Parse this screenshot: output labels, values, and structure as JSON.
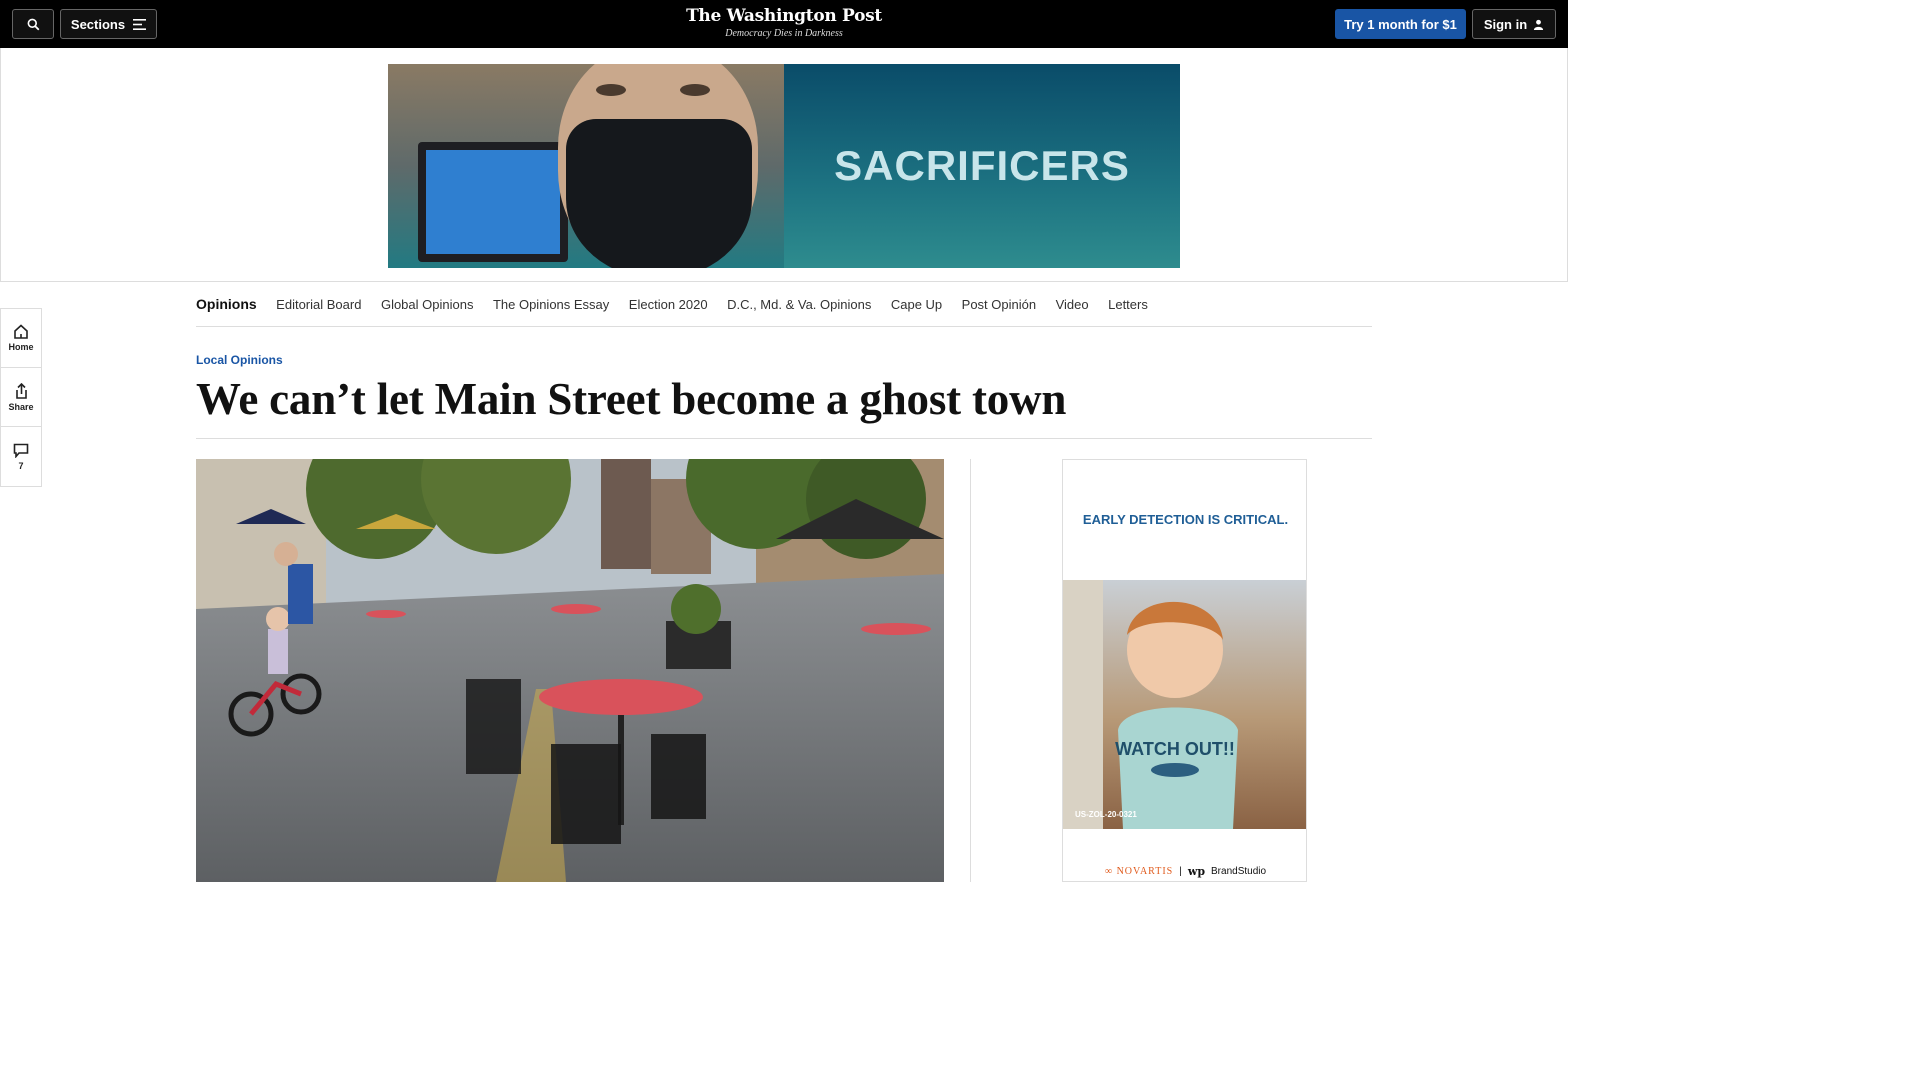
{
  "header": {
    "sections_label": "Sections",
    "logo_name": "The Washington Post",
    "logo_tagline": "Democracy Dies in Darkness",
    "subscribe_label": "Try 1 month for $1",
    "signin_label": "Sign in",
    "icons": {
      "search": "search-icon",
      "menu": "hamburger-icon",
      "user": "user-icon"
    }
  },
  "top_ad": {
    "headline": "SACRIFICERS"
  },
  "rail": {
    "home_label": "Home",
    "share_label": "Share",
    "comments_count": "7"
  },
  "subnav": {
    "items": [
      "Opinions",
      "Editorial Board",
      "Global Opinions",
      "The Opinions Essay",
      "Election 2020",
      "D.C., Md. & Va. Opinions",
      "Cape Up",
      "Post Opinión",
      "Video",
      "Letters"
    ]
  },
  "article": {
    "kicker": "Local Opinions",
    "headline": "We can’t let Main Street become a ghost town"
  },
  "side_ad": {
    "headline": "EARLY DETECTION IS CRITICAL.",
    "code": "US-ZOL-20-0321",
    "shirt_text": "WATCH OUT!!",
    "sponsor": "NOVARTIS",
    "partner": "BrandStudio",
    "partner_mark": "wp",
    "colors": {
      "headline": "#1f5e96",
      "sponsor": "#e05a1c"
    }
  },
  "colors": {
    "accent": "#1955a5",
    "topbar": "#000000"
  }
}
